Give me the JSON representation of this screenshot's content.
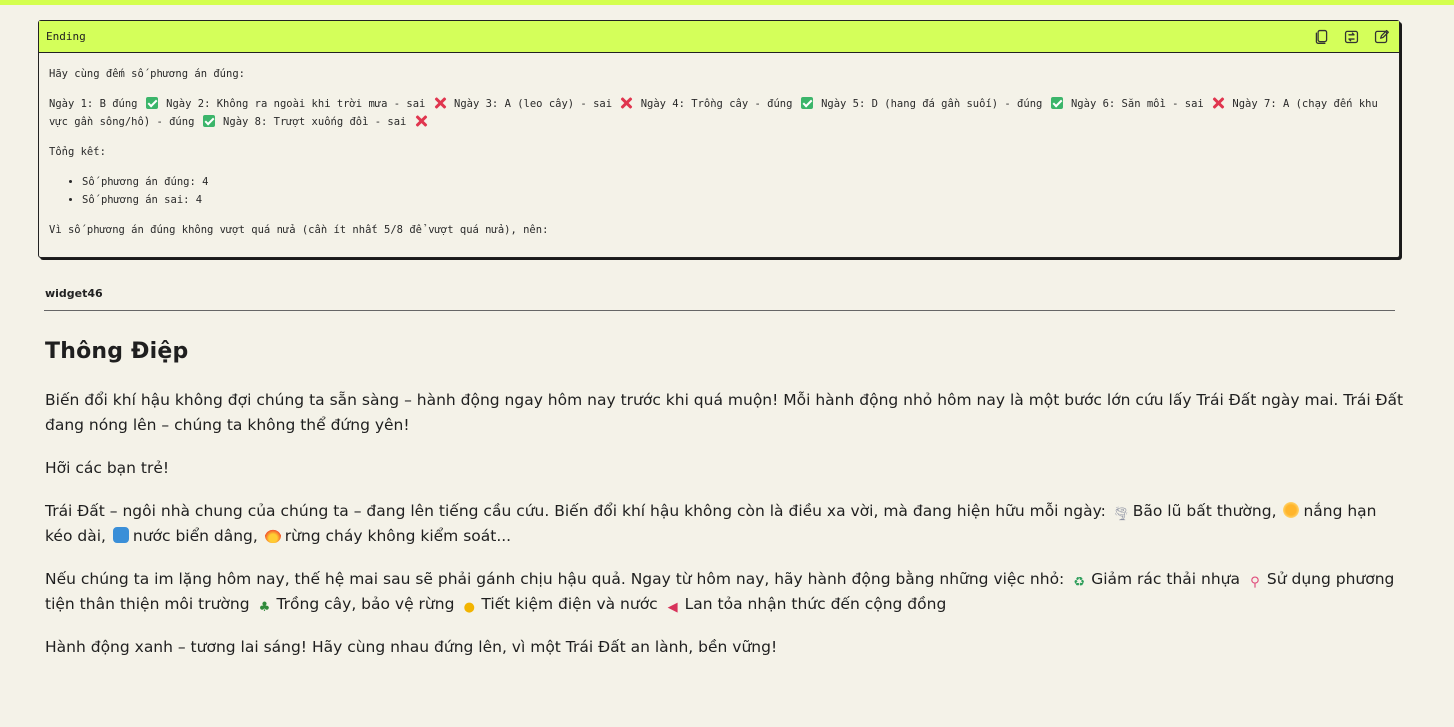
{
  "card": {
    "title": "Ending",
    "actions": [
      {
        "name": "copy-icon"
      },
      {
        "name": "refresh-icon"
      },
      {
        "name": "edit-icon"
      }
    ],
    "intro": "Hãy cùng đếm số phương án đúng:",
    "days": [
      {
        "text": "Ngày 1: B đúng",
        "result": "correct"
      },
      {
        "text": "Ngày 2: Không ra ngoài khi trời mưa - sai",
        "result": "wrong"
      },
      {
        "text": "Ngày 3: A (leo cây) - sai",
        "result": "wrong"
      },
      {
        "text": "Ngày 4: Trồng cây - đúng",
        "result": "correct"
      },
      {
        "text": "Ngày 5: D (hang đá gần suối) - đúng",
        "result": "correct"
      },
      {
        "text": "Ngày 6: Săn mồi - sai",
        "result": "wrong"
      },
      {
        "text": "Ngày 7: A (chạy đến khu vực gần sông/hồ) - đúng",
        "result": "correct"
      },
      {
        "text": "Ngày 8: Trượt xuống đồi - sai",
        "result": "wrong"
      }
    ],
    "summary_label": "Tổng kết:",
    "summary_items": [
      "Số phương án đúng: 4",
      "Số phương án sai: 4"
    ],
    "conclusion": "Vì số phương án đúng không vượt quá nửa (cần ít nhất 5/8 để vượt quá nửa), nên:"
  },
  "widget": {
    "label": "widget46"
  },
  "message": {
    "heading": "Thông Điệp",
    "p1": "Biến đổi khí hậu không đợi chúng ta sẵn sàng – hành động ngay hôm nay trước khi quá muộn! Mỗi hành động nhỏ hôm nay là một bước lớn cứu lấy Trái Đất ngày mai. Trái Đất đang nóng lên – chúng ta không thể đứng yên!",
    "p2": "Hỡi các bạn trẻ!",
    "p3_intro": "Trái Đất – ngôi nhà chung của chúng ta – đang lên tiếng cầu cứu. Biến đổi khí hậu không còn là điều xa vời, mà đang hiện hữu mỗi ngày:",
    "p3_items": [
      {
        "icon": "tornado-icon",
        "text": "Bão lũ bất thường,"
      },
      {
        "icon": "sun-icon",
        "text": "nắng hạn kéo dài,"
      },
      {
        "icon": "wave-icon",
        "text": "nước biển dâng,"
      },
      {
        "icon": "fire-icon",
        "text": "rừng cháy không kiểm soát..."
      }
    ],
    "p4_intro": "Nếu chúng ta im lặng hôm nay, thế hệ mai sau sẽ phải gánh chịu hậu quả. Ngay từ hôm nay, hãy hành động bằng những việc nhỏ:",
    "p4_items": [
      {
        "icon": "recycle-icon",
        "text": "Giảm rác thải nhựa"
      },
      {
        "icon": "bicycle-icon",
        "text": "Sử dụng phương tiện thân thiện môi trường"
      },
      {
        "icon": "tree-icon",
        "text": "Trồng cây, bảo vệ rừng"
      },
      {
        "icon": "lightbulb-icon",
        "text": "Tiết kiệm điện và nước"
      },
      {
        "icon": "megaphone-icon",
        "text": "Lan tỏa nhận thức đến cộng đồng"
      }
    ],
    "p5": "Hành động xanh – tương lai sáng! Hãy cùng nhau đứng lên, vì một Trái Đất an lành, bền vững!"
  },
  "colors": {
    "accent": "#d4ff5a",
    "background": "#f4f2e8",
    "correct": "#3bb56a",
    "wrong": "#e0364f"
  }
}
